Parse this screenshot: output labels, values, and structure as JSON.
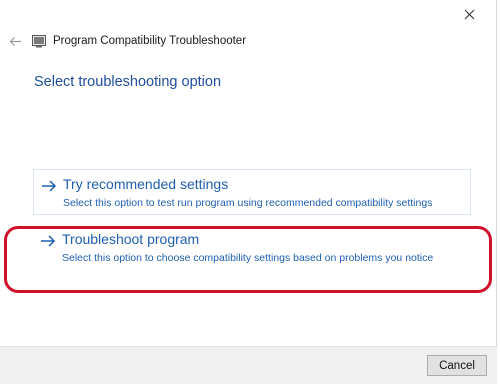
{
  "window": {
    "title": "Program Compatibility Troubleshooter",
    "icons": {
      "back": "back-arrow-icon",
      "app": "troubleshooter-icon",
      "close": "close-icon"
    }
  },
  "main": {
    "heading": "Select troubleshooting option",
    "options": [
      {
        "label": "Try recommended settings",
        "description": "Select this option to test run program using recommended compatibility settings",
        "icon": "arrow-right-icon"
      },
      {
        "label": "Troubleshoot program",
        "description": "Select this option to choose compatibility settings based on problems you notice",
        "icon": "arrow-right-icon",
        "highlighted": true
      }
    ]
  },
  "footer": {
    "cancel_label": "Cancel"
  },
  "colors": {
    "accent": "#1f5fb1",
    "heading": "#1f4e9b",
    "highlight": "#d0102a",
    "footer_bg": "#f0f0f0"
  }
}
